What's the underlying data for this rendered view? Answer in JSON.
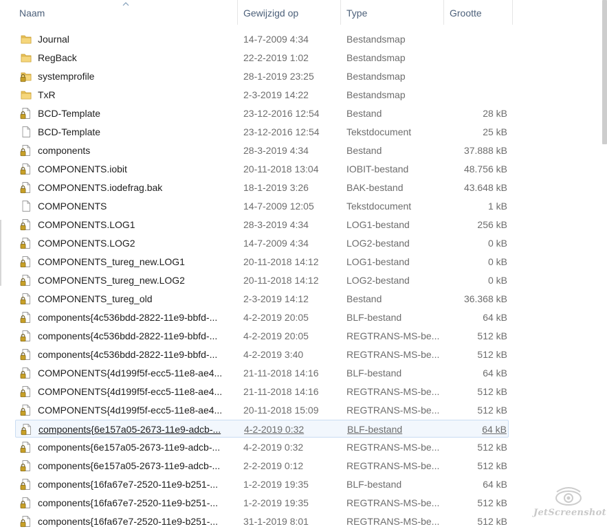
{
  "columns": {
    "name": "Naam",
    "modified": "Gewijzigd op",
    "type": "Type",
    "size": "Grootte"
  },
  "files": [
    {
      "icon": "folder",
      "name": "Journal",
      "modified": "14-7-2009 4:34",
      "type": "Bestandsmap",
      "size": ""
    },
    {
      "icon": "folder",
      "name": "RegBack",
      "modified": "22-2-2019 1:02",
      "type": "Bestandsmap",
      "size": ""
    },
    {
      "icon": "folder-locked",
      "name": "systemprofile",
      "modified": "28-1-2019 23:25",
      "type": "Bestandsmap",
      "size": ""
    },
    {
      "icon": "folder",
      "name": "TxR",
      "modified": "2-3-2019 14:22",
      "type": "Bestandsmap",
      "size": ""
    },
    {
      "icon": "file-locked",
      "name": "BCD-Template",
      "modified": "23-12-2016 12:54",
      "type": "Bestand",
      "size": "28 kB"
    },
    {
      "icon": "file",
      "name": "BCD-Template",
      "modified": "23-12-2016 12:54",
      "type": "Tekstdocument",
      "size": "25 kB"
    },
    {
      "icon": "file-locked",
      "name": "components",
      "modified": "28-3-2019 4:34",
      "type": "Bestand",
      "size": "37.888 kB"
    },
    {
      "icon": "file-locked",
      "name": "COMPONENTS.iobit",
      "modified": "20-11-2018 13:04",
      "type": "IOBIT-bestand",
      "size": "48.756 kB"
    },
    {
      "icon": "file-locked",
      "name": "COMPONENTS.iodefrag.bak",
      "modified": "18-1-2019 3:26",
      "type": "BAK-bestand",
      "size": "43.648 kB"
    },
    {
      "icon": "file",
      "name": "COMPONENTS",
      "modified": "14-7-2009 12:05",
      "type": "Tekstdocument",
      "size": "1 kB"
    },
    {
      "icon": "file-locked",
      "name": "COMPONENTS.LOG1",
      "modified": "28-3-2019 4:34",
      "type": "LOG1-bestand",
      "size": "256 kB"
    },
    {
      "icon": "file-locked",
      "name": "COMPONENTS.LOG2",
      "modified": "14-7-2009 4:34",
      "type": "LOG2-bestand",
      "size": "0 kB"
    },
    {
      "icon": "file-locked",
      "name": "COMPONENTS_tureg_new.LOG1",
      "modified": "20-11-2018 14:12",
      "type": "LOG1-bestand",
      "size": "0 kB"
    },
    {
      "icon": "file-locked",
      "name": "COMPONENTS_tureg_new.LOG2",
      "modified": "20-11-2018 14:12",
      "type": "LOG2-bestand",
      "size": "0 kB"
    },
    {
      "icon": "file-locked",
      "name": "COMPONENTS_tureg_old",
      "modified": "2-3-2019 14:12",
      "type": "Bestand",
      "size": "36.368 kB"
    },
    {
      "icon": "file-locked",
      "name": "components{4c536bdd-2822-11e9-bbfd-...",
      "modified": "4-2-2019 20:05",
      "type": "BLF-bestand",
      "size": "64 kB"
    },
    {
      "icon": "file-locked",
      "name": "components{4c536bdd-2822-11e9-bbfd-...",
      "modified": "4-2-2019 20:05",
      "type": "REGTRANS-MS-be...",
      "size": "512 kB"
    },
    {
      "icon": "file-locked",
      "name": "components{4c536bdd-2822-11e9-bbfd-...",
      "modified": "4-2-2019 3:40",
      "type": "REGTRANS-MS-be...",
      "size": "512 kB"
    },
    {
      "icon": "file-locked",
      "name": "COMPONENTS{4d199f5f-ecc5-11e8-ae4...",
      "modified": "21-11-2018 14:16",
      "type": "BLF-bestand",
      "size": "64 kB"
    },
    {
      "icon": "file-locked",
      "name": "COMPONENTS{4d199f5f-ecc5-11e8-ae4...",
      "modified": "21-11-2018 14:16",
      "type": "REGTRANS-MS-be...",
      "size": "512 kB"
    },
    {
      "icon": "file-locked",
      "name": "COMPONENTS{4d199f5f-ecc5-11e8-ae4...",
      "modified": "20-11-2018 15:09",
      "type": "REGTRANS-MS-be...",
      "size": "512 kB"
    },
    {
      "icon": "file-locked",
      "name": "components{6e157a05-2673-11e9-adcb-...",
      "modified": "4-2-2019 0:32",
      "type": "BLF-bestand",
      "size": "64 kB",
      "selected": true
    },
    {
      "icon": "file-locked",
      "name": "components{6e157a05-2673-11e9-adcb-...",
      "modified": "4-2-2019 0:32",
      "type": "REGTRANS-MS-be...",
      "size": "512 kB"
    },
    {
      "icon": "file-locked",
      "name": "components{6e157a05-2673-11e9-adcb-...",
      "modified": "2-2-2019 0:12",
      "type": "REGTRANS-MS-be...",
      "size": "512 kB"
    },
    {
      "icon": "file-locked",
      "name": "components{16fa67e7-2520-11e9-b251-...",
      "modified": "1-2-2019 19:35",
      "type": "BLF-bestand",
      "size": "64 kB"
    },
    {
      "icon": "file-locked",
      "name": "components{16fa67e7-2520-11e9-b251-...",
      "modified": "1-2-2019 19:35",
      "type": "REGTRANS-MS-be...",
      "size": "512 kB"
    },
    {
      "icon": "file-locked",
      "name": "components{16fa67e7-2520-11e9-b251-...",
      "modified": "31-1-2019 8:01",
      "type": "REGTRANS-MS-be...",
      "size": "512 kB"
    }
  ],
  "watermark": "JetScreenshot",
  "colors": {
    "header_text": "#4c607a",
    "selected_bg": "#f2f7fd",
    "selected_border": "#c9dcf3",
    "folder": "#e8c15a",
    "lock": "#c8a028"
  }
}
